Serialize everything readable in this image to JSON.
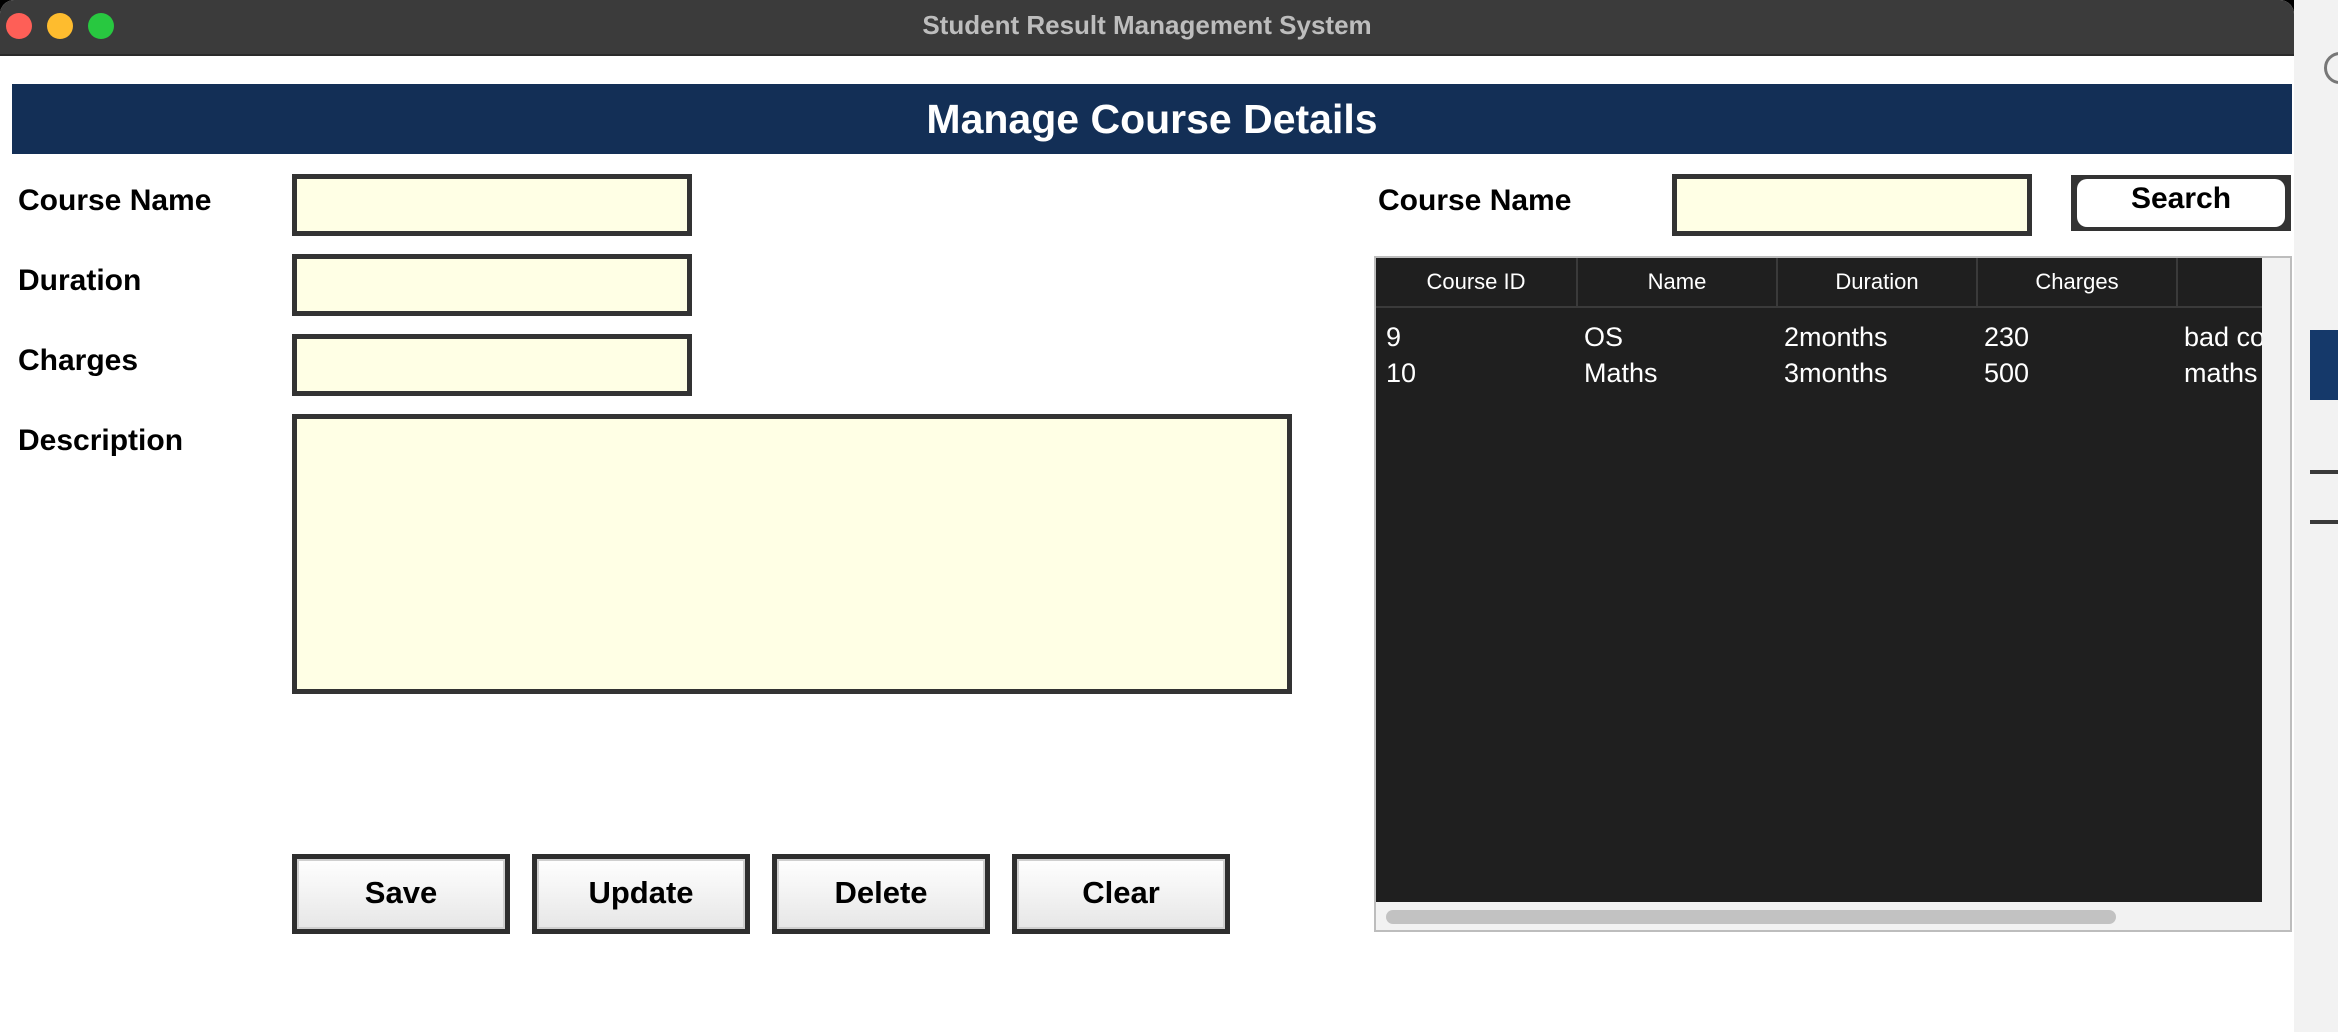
{
  "window": {
    "title": "Student Result Management System"
  },
  "banner": {
    "title": "Manage Course Details"
  },
  "form": {
    "course_name_label": "Course Name",
    "duration_label": "Duration",
    "charges_label": "Charges",
    "description_label": "Description",
    "course_name_value": "",
    "duration_value": "",
    "charges_value": "",
    "description_value": ""
  },
  "buttons": {
    "save": "Save",
    "update": "Update",
    "delete": "Delete",
    "clear": "Clear"
  },
  "search": {
    "label": "Course Name",
    "value": "",
    "button": "Search"
  },
  "table": {
    "headers": [
      "Course ID",
      "Name",
      "Duration",
      "Charges",
      ""
    ],
    "rows": [
      [
        "9",
        "OS",
        "2months",
        "230",
        "bad co"
      ],
      [
        "10",
        "Maths",
        "3months",
        "500",
        "maths"
      ]
    ]
  },
  "colors": {
    "banner_bg": "#132f56",
    "field_bg": "#ffffe5",
    "table_bg": "#1f1f1f",
    "titlebar_bg": "#3b3b3b"
  }
}
